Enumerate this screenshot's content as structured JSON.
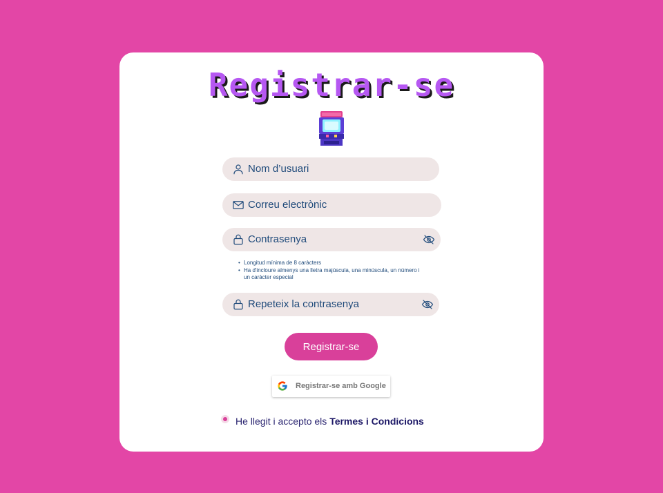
{
  "colors": {
    "background": "#e346a6",
    "card": "#ffffff",
    "accent": "#d9409a",
    "title": "#b658f2",
    "field_bg": "#efe6e6",
    "field_text": "#1f4a7a"
  },
  "form": {
    "title": "Registrar-se",
    "logo_icon": "arcade-machine-icon",
    "username": {
      "placeholder": "Nom d’usuari",
      "icon": "user-icon"
    },
    "email": {
      "placeholder": "Correu electrònic",
      "icon": "mail-icon"
    },
    "password": {
      "placeholder": "Contrasenya",
      "icon": "lock-icon",
      "toggle_icon": "eye-off-icon"
    },
    "password_hints": [
      "Longitud mínima de 8 caràcters",
      "Ha d'incloure almenys una lletra majúscula, una minúscula, un número i un caràcter especial"
    ],
    "confirm_password": {
      "placeholder": "Repeteix la contrasenya",
      "icon": "lock-icon",
      "toggle_icon": "eye-off-icon"
    },
    "submit_label": "Registrar-se",
    "google_label": "Registrar-se amb Google",
    "terms": {
      "prefix": "He llegit i accepto els ",
      "link": "Termes i Condicions",
      "checked": true
    }
  }
}
